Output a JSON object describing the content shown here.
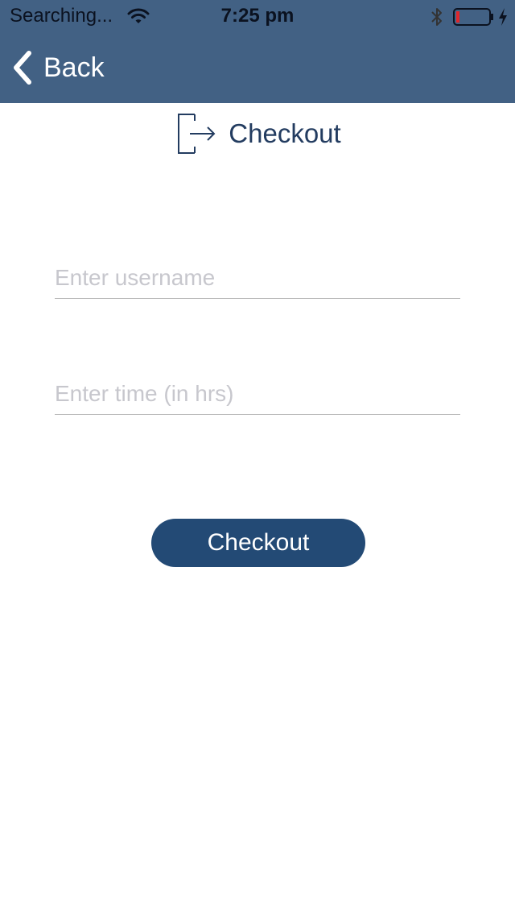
{
  "status_bar": {
    "carrier": "Searching...",
    "time": "7:25 pm",
    "icons": [
      "wifi-icon",
      "bluetooth-icon",
      "battery-icon",
      "charging-icon"
    ]
  },
  "nav": {
    "back_label": "Back",
    "back_icon": "chevron-left-icon"
  },
  "page": {
    "title": "Checkout",
    "title_icon": "checkout-icon"
  },
  "form": {
    "username_placeholder": "Enter username",
    "username_value": "",
    "time_placeholder": "Enter time (in hrs)",
    "time_value": "",
    "submit_label": "Checkout"
  },
  "colors": {
    "header_bg": "#426184",
    "title": "#233c60",
    "button_bg": "#234a75",
    "battery_low": "#e0262b"
  }
}
